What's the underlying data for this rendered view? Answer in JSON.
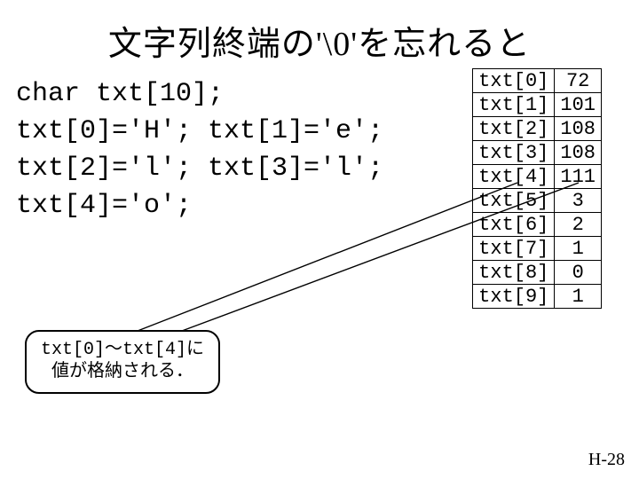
{
  "title": "文字列終端の'\\0'を忘れると",
  "code": {
    "l0": "char txt[10];",
    "l1": "txt[0]='H'; txt[1]='e';",
    "l2": "txt[2]='l'; txt[3]='l';",
    "l3": "txt[4]='o';"
  },
  "table": [
    {
      "label": "txt[0]",
      "value": "72"
    },
    {
      "label": "txt[1]",
      "value": "101"
    },
    {
      "label": "txt[2]",
      "value": "108"
    },
    {
      "label": "txt[3]",
      "value": "108"
    },
    {
      "label": "txt[4]",
      "value": "111"
    },
    {
      "label": "txt[5]",
      "value": "3"
    },
    {
      "label": "txt[6]",
      "value": "2"
    },
    {
      "label": "txt[7]",
      "value": "1"
    },
    {
      "label": "txt[8]",
      "value": "0"
    },
    {
      "label": "txt[9]",
      "value": "1"
    }
  ],
  "callout": {
    "line1": "txt[0]～txt[4]に",
    "line2": "値が格納される．"
  },
  "pagenum": "H-28"
}
